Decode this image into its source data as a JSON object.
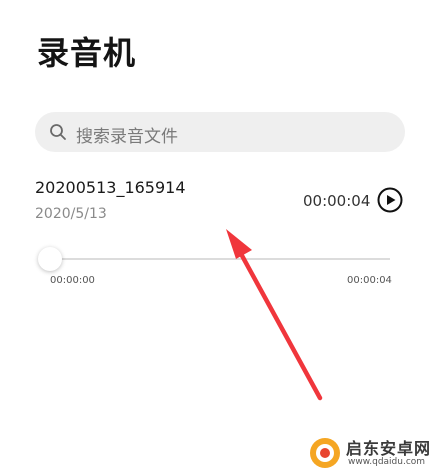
{
  "app": {
    "title": "录音机"
  },
  "search": {
    "placeholder": "搜索录音文件",
    "icon": "search-icon"
  },
  "recordings": [
    {
      "name": "20200513_165914",
      "date": "2020/5/13",
      "duration": "00:00:04",
      "play_icon": "play-icon",
      "player": {
        "current_time": "00:00:00",
        "total_time": "00:00:04",
        "progress": 0
      }
    }
  ],
  "watermark": {
    "name": "启东安卓网",
    "url": "www.qdaidu.com"
  },
  "colors": {
    "annotation_arrow": "#f0363c",
    "background": "#ffffff",
    "search_bg": "#efefef"
  }
}
